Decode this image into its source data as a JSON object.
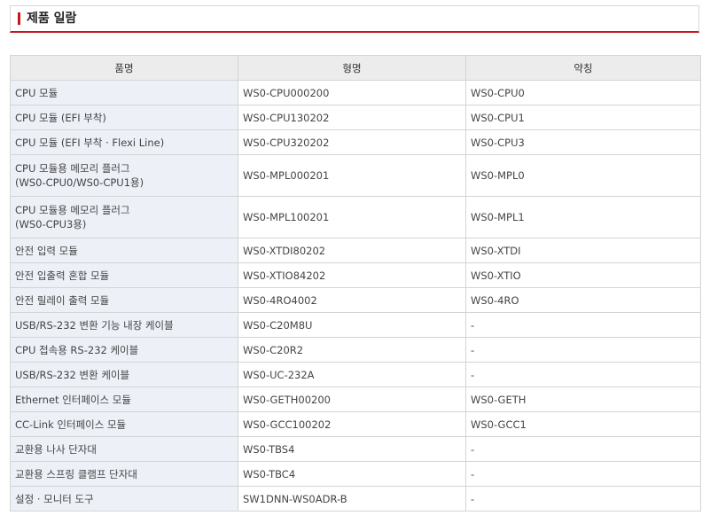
{
  "colors": {
    "accent": "#c8161d",
    "name_column_bg": "#edf0f7",
    "header_bg": "#ececec"
  },
  "section": {
    "title": "제품 일람"
  },
  "table": {
    "headers": [
      "품명",
      "형명",
      "약칭"
    ],
    "rows": [
      {
        "name": [
          "CPU 모듈"
        ],
        "model": "WS0-CPU000200",
        "abbr": "WS0-CPU0"
      },
      {
        "name": [
          "CPU 모듈 (EFI 부착)"
        ],
        "model": "WS0-CPU130202",
        "abbr": "WS0-CPU1"
      },
      {
        "name": [
          "CPU 모듈 (EFI 부착 · Flexi Line)"
        ],
        "model": "WS0-CPU320202",
        "abbr": "WS0-CPU3"
      },
      {
        "name": [
          "CPU 모듈용 메모리 플러그",
          "(WS0-CPU0/WS0-CPU1용)"
        ],
        "model": "WS0-MPL000201",
        "abbr": "WS0-MPL0"
      },
      {
        "name": [
          "CPU 모듈용 메모리 플러그",
          "(WS0-CPU3용)"
        ],
        "model": "WS0-MPL100201",
        "abbr": "WS0-MPL1"
      },
      {
        "name": [
          "안전 입력 모듈"
        ],
        "model": "WS0-XTDI80202",
        "abbr": "WS0-XTDI"
      },
      {
        "name": [
          "안전 입출력 혼합 모듈"
        ],
        "model": "WS0-XTIO84202",
        "abbr": "WS0-XTIO"
      },
      {
        "name": [
          "안전 릴레이 출력 모듈"
        ],
        "model": "WS0-4RO4002",
        "abbr": "WS0-4RO"
      },
      {
        "name": [
          "USB/RS-232 변환 기능 내장 케이블"
        ],
        "model": "WS0-C20M8U",
        "abbr": "-"
      },
      {
        "name": [
          "CPU 접속용 RS-232 케이블"
        ],
        "model": "WS0-C20R2",
        "abbr": "-"
      },
      {
        "name": [
          "USB/RS-232 변환 케이블"
        ],
        "model": "WS0-UC-232A",
        "abbr": "-"
      },
      {
        "name": [
          "Ethernet 인터페이스 모듈"
        ],
        "model": "WS0-GETH00200",
        "abbr": "WS0-GETH"
      },
      {
        "name": [
          "CC-Link 인터페이스 모듈"
        ],
        "model": "WS0-GCC100202",
        "abbr": "WS0-GCC1"
      },
      {
        "name": [
          "교환용 나사 단자대"
        ],
        "model": "WS0-TBS4",
        "abbr": "-"
      },
      {
        "name": [
          "교환용 스프링 클램프 단자대"
        ],
        "model": "WS0-TBC4",
        "abbr": "-"
      },
      {
        "name": [
          "설정 · 모니터 도구"
        ],
        "model": "SW1DNN-WS0ADR-B",
        "abbr": "-"
      }
    ]
  }
}
